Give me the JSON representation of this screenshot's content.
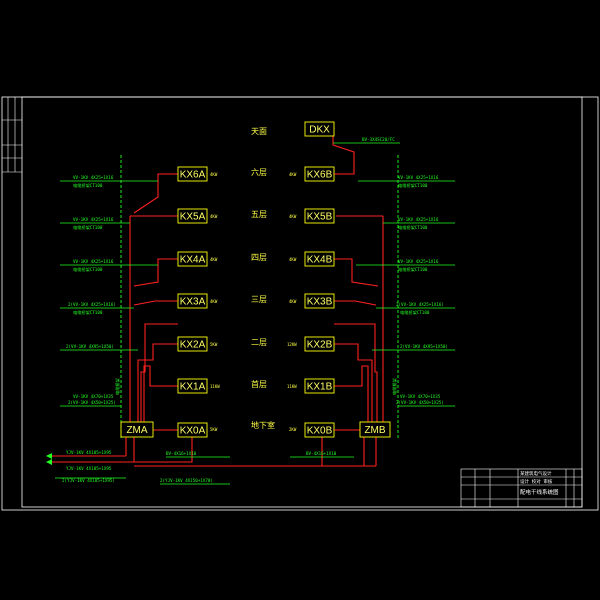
{
  "drawing": {
    "title_block": {
      "title": "配电干线系统图",
      "rows": [
        "某建筑电气设计",
        "设计 校对 审核"
      ]
    }
  },
  "floors": [
    {
      "id": "roof",
      "label": "天面"
    },
    {
      "id": "f6",
      "label": "六层"
    },
    {
      "id": "f5",
      "label": "五层"
    },
    {
      "id": "f4",
      "label": "四层"
    },
    {
      "id": "f3",
      "label": "三层"
    },
    {
      "id": "f2",
      "label": "二层"
    },
    {
      "id": "f1",
      "label": "首层"
    },
    {
      "id": "b1",
      "label": "地下室"
    }
  ],
  "panels": {
    "top": "DKX",
    "main_left": "ZMA",
    "main_right": "ZMB",
    "left": [
      "KX6A",
      "KX5A",
      "KX4A",
      "KX3A",
      "KX2A",
      "KX1A",
      "KX0A"
    ],
    "right": [
      "KX6B",
      "KX5B",
      "KX4B",
      "KX3B",
      "KX2B",
      "KX1B",
      "KX0B"
    ]
  },
  "loads_left": [
    "4KW",
    "4KW",
    "4KW",
    "4KW",
    "5KW",
    "11KW",
    "5KW"
  ],
  "loads_right": [
    "4KW",
    "4KW",
    "4KW",
    "4KW",
    "12KW",
    "11KW",
    "2KW"
  ],
  "dkx_cable": "BV-3X4SC20/FC",
  "cables": {
    "left": [
      [
        "VV-1KV 4X25+1X16",
        "电缆桥架CT100"
      ],
      [
        "VV-1KV 4X25+1X16",
        "电缆桥架CT100"
      ],
      [
        "VV-1KV 4X25+1X16",
        "电缆桥架CT100"
      ],
      [
        "2(VV-1KV 4X25+1X16)",
        "电缆桥架CT100"
      ],
      [
        "2(VV-1KV 4X95+1X50)",
        ""
      ],
      [
        "VV-1KV 4X70+1X35",
        "2(VV-1KV 4X50+1X25)"
      ]
    ],
    "right": [
      [
        "VV-1KV 4X25+1X16",
        "电缆桥架CT100"
      ],
      [
        "VV-1KV 4X25+1X16",
        "电缆桥架CT100"
      ],
      [
        "VV-1KV 4X25+1X16",
        "电缆桥架CT100"
      ],
      [
        "2(VV-1KV 4X25+1X16)",
        "电缆桥架CT100"
      ],
      [
        "2(VV-1KV 4X95+1X50)",
        ""
      ],
      [
        "VV-1KV 4X70+1X35",
        "2(VV-1KV 4X50+1X25)"
      ]
    ],
    "b1_left": "BV-4X16+1X10",
    "b1_right": "BV-4X16+1X10",
    "incoming": [
      "YJV-1KV 4X185+1X95",
      "YJV-1KV 4X185+1X95",
      "2(YJV-1KV 4X185+1X95)"
    ],
    "feeder_bottom": "2(YJV-1KV 4X150+1X70)"
  },
  "colors": {
    "background": "#000000",
    "frame": "#ffffff",
    "panel_border": "#ffff00",
    "power_line": "#ff2222",
    "dashed_riser": "#22ff22",
    "text_yellow": "#ffff44",
    "text_green": "#22ff22"
  }
}
